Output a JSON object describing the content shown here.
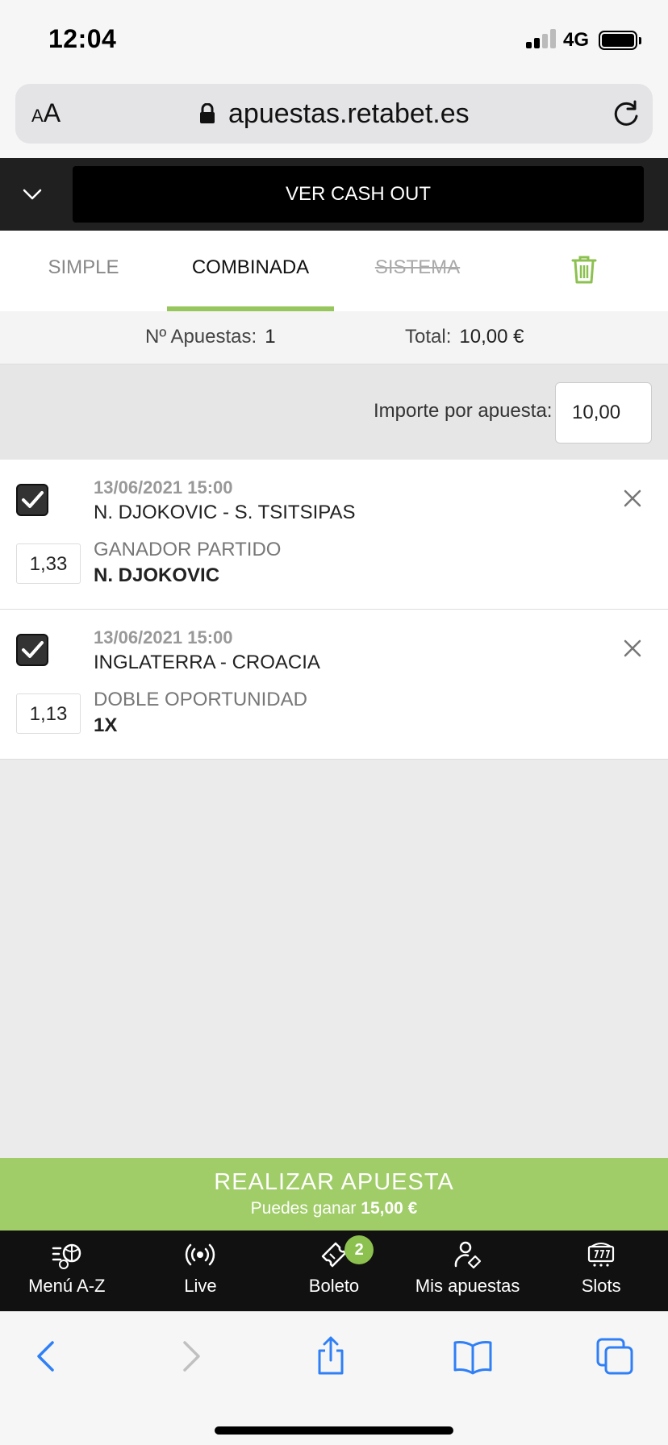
{
  "status": {
    "time": "12:04",
    "network": "4G"
  },
  "browser": {
    "text_size_label": "AA",
    "url": "apuestas.retabet.es"
  },
  "cashout": {
    "button_label": "VER CASH OUT"
  },
  "tabs": [
    {
      "label": "SIMPLE"
    },
    {
      "label": "COMBINADA"
    },
    {
      "label": "SISTEMA"
    }
  ],
  "summary": {
    "bets_label": "Nº Apuestas:",
    "bets_value": "1",
    "total_label": "Total:",
    "total_value": "10,00 €"
  },
  "stake": {
    "label": "Importe por apuesta:",
    "value": "10,00"
  },
  "bets": [
    {
      "date": "13/06/2021 15:00",
      "match": "N. DJOKOVIC - S. TSITSIPAS",
      "market": "GANADOR PARTIDO",
      "pick": "N. DJOKOVIC",
      "odds": "1,33"
    },
    {
      "date": "13/06/2021 15:00",
      "match": "INGLATERRA - CROACIA",
      "market": "DOBLE OPORTUNIDAD",
      "pick": "1X",
      "odds": "1,13"
    }
  ],
  "place_bet": {
    "title": "REALIZAR APUESTA",
    "subtitle": "Puedes ganar",
    "amount": "15,00 €"
  },
  "bottom_nav": [
    {
      "label": "Menú A-Z",
      "icon": "sports-menu-icon"
    },
    {
      "label": "Live",
      "icon": "live-broadcast-icon"
    },
    {
      "label": "Boleto",
      "icon": "ticket-icon",
      "badge": "2"
    },
    {
      "label": "Mis apuestas",
      "icon": "user-bets-icon"
    },
    {
      "label": "Slots",
      "icon": "slot-machine-icon"
    }
  ],
  "colors": {
    "accent": "#a0cd67",
    "dark": "#111111",
    "tab_underline": "#97c65d"
  }
}
